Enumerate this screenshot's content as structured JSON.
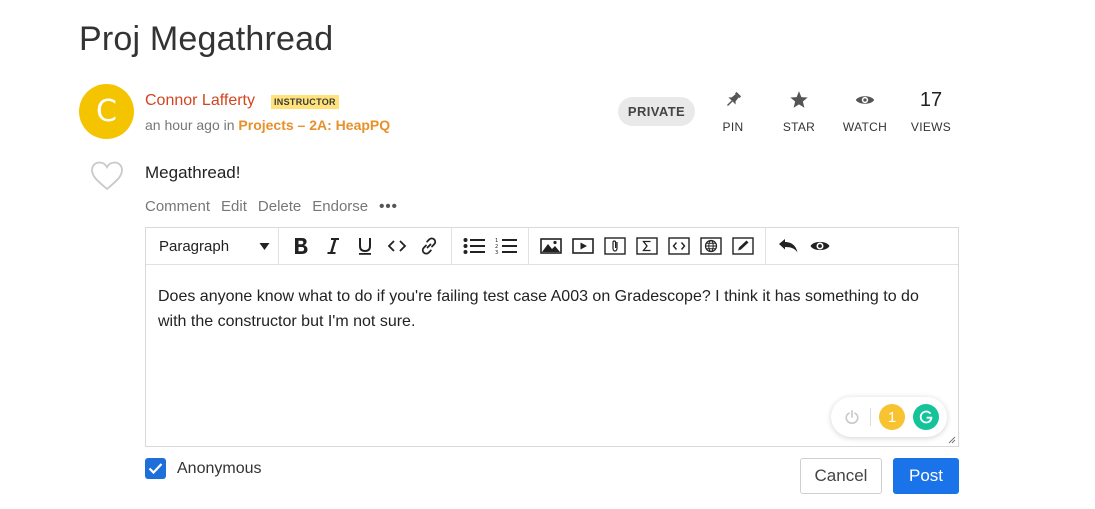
{
  "post": {
    "title": "Proj Megathread",
    "author_initial": "C",
    "author": "Connor Lafferty",
    "author_badge": "INSTRUCTOR",
    "time": "an hour ago",
    "in_word": "in",
    "folder": "Projects – 2A: HeapPQ",
    "visibility": "PRIVATE",
    "body": "Megathread!"
  },
  "actions": {
    "pin": "PIN",
    "star": "STAR",
    "watch": "WATCH",
    "views_count": "17",
    "views": "VIEWS"
  },
  "post_links": {
    "comment": "Comment",
    "edit": "Edit",
    "delete": "Delete",
    "endorse": "Endorse",
    "more": "•••"
  },
  "editor": {
    "block_format": "Paragraph",
    "content": "Does anyone know what to do if you're failing test case A003 on Gradescope? I think it has something to do with the constructor but I'm not sure.",
    "toolbar_icons": [
      "bold-icon",
      "italic-icon",
      "underline-icon",
      "code-icon",
      "link-icon",
      "bullet-list-icon",
      "numbered-list-icon",
      "image-icon",
      "video-icon",
      "attachment-icon",
      "math-icon",
      "code-block-icon",
      "web-embed-icon",
      "draw-icon",
      "undo-icon",
      "preview-icon"
    ]
  },
  "grammarly": {
    "suggestion_count": "1"
  },
  "footer": {
    "anonymous_label": "Anonymous",
    "anonymous_checked": true,
    "cancel": "Cancel",
    "post": "Post"
  },
  "colors": {
    "author": "#d1451f",
    "folder": "#e8902a",
    "avatar": "#f5c400",
    "badge": "#ffe37a",
    "primary": "#1a73e8",
    "grammarly": "#15c39a"
  }
}
